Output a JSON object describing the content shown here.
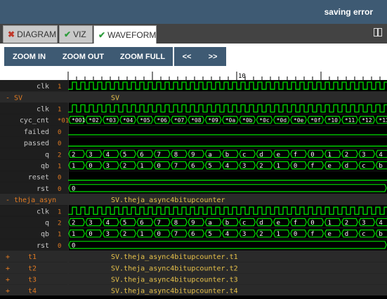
{
  "header": {
    "status": "saving error"
  },
  "tabs": [
    {
      "label": "DIAGRAM",
      "icon": "x-icon"
    },
    {
      "label": "VIZ",
      "icon": "check-icon"
    },
    {
      "label": "WAVEFORM",
      "icon": "check-icon"
    }
  ],
  "toolbar": {
    "zoom_in": "ZOOM IN",
    "zoom_out": "ZOOM OUT",
    "zoom_full": "ZOOM FULL",
    "prev": "<<",
    "next": ">>"
  },
  "ruler": {
    "tick_label": "10"
  },
  "colors": {
    "signal": "#00e000",
    "name": "#c8c8c8",
    "value": "#e07a22",
    "group": "#e07a22",
    "path": "#e8c24a",
    "bus_text": "#ffffff"
  },
  "rows": [
    {
      "kind": "signal",
      "name": "clk",
      "value": "1",
      "wave": "clock"
    },
    {
      "kind": "group",
      "toggle": "-",
      "name": "SV",
      "path": "SV"
    },
    {
      "kind": "signal",
      "name": "clk",
      "value": "1",
      "wave": "clock"
    },
    {
      "kind": "signal",
      "name": "cyc_cnt",
      "value": "*01",
      "wave": "bus",
      "cells": [
        "*001",
        "*02",
        "*03",
        "*04",
        "*05",
        "*06",
        "*07",
        "*08",
        "*09",
        "*0a",
        "*0b",
        "*0c",
        "*0d",
        "*0e",
        "*0f",
        "*10",
        "*11",
        "*12",
        "*13"
      ]
    },
    {
      "kind": "signal",
      "name": "failed",
      "value": "0",
      "wave": "low"
    },
    {
      "kind": "signal",
      "name": "passed",
      "value": "0",
      "wave": "low"
    },
    {
      "kind": "signal",
      "name": "q",
      "value": "2",
      "wave": "bus",
      "cells": [
        "2",
        "3",
        "4",
        "5",
        "6",
        "7",
        "8",
        "9",
        "a",
        "b",
        "c",
        "d",
        "e",
        "f",
        "0",
        "1",
        "2",
        "3",
        "4"
      ]
    },
    {
      "kind": "signal",
      "name": "qb",
      "value": "1",
      "wave": "bus",
      "cells": [
        "1",
        "0",
        "3",
        "2",
        "1",
        "0",
        "7",
        "6",
        "5",
        "4",
        "3",
        "2",
        "1",
        "0",
        "f",
        "e",
        "d",
        "c",
        "b"
      ]
    },
    {
      "kind": "signal",
      "name": "reset",
      "value": "0",
      "wave": "low"
    },
    {
      "kind": "signal",
      "name": "rst",
      "value": "0",
      "wave": "bus",
      "cells": [
        "0"
      ]
    },
    {
      "kind": "group",
      "toggle": "-",
      "name": "theja_async4bitupcounter",
      "path": "SV.theja_async4bitupcounter"
    },
    {
      "kind": "signal",
      "name": "clk",
      "value": "1",
      "wave": "clock"
    },
    {
      "kind": "signal",
      "name": "q",
      "value": "2",
      "wave": "bus",
      "cells": [
        "2",
        "3",
        "4",
        "5",
        "6",
        "7",
        "8",
        "9",
        "a",
        "b",
        "c",
        "d",
        "e",
        "f",
        "0",
        "1",
        "2",
        "3",
        "4"
      ]
    },
    {
      "kind": "signal",
      "name": "qb",
      "value": "1",
      "wave": "bus",
      "cells": [
        "1",
        "0",
        "3",
        "2",
        "1",
        "0",
        "7",
        "6",
        "5",
        "4",
        "3",
        "2",
        "1",
        "0",
        "f",
        "e",
        "d",
        "c",
        "b"
      ]
    },
    {
      "kind": "signal",
      "name": "rst",
      "value": "0",
      "wave": "bus",
      "cells": [
        "0"
      ]
    },
    {
      "kind": "group",
      "toggle": "+",
      "name": "t1",
      "path": "SV.theja_async4bitupcounter.t1"
    },
    {
      "kind": "group",
      "toggle": "+",
      "name": "t2",
      "path": "SV.theja_async4bitupcounter.t2"
    },
    {
      "kind": "group",
      "toggle": "+",
      "name": "t3",
      "path": "SV.theja_async4bitupcounter.t3"
    },
    {
      "kind": "group",
      "toggle": "+",
      "name": "t4",
      "path": "SV.theja_async4bitupcounter.t4"
    }
  ]
}
